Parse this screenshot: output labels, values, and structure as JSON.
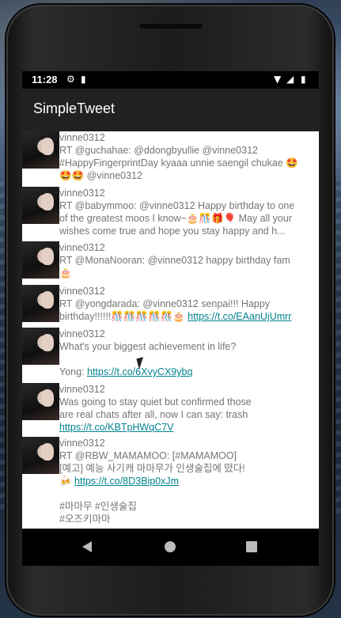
{
  "status_bar": {
    "time": "11:28",
    "icons": [
      "gear-icon",
      "sd-card-icon",
      "wifi-icon",
      "signal-icon",
      "battery-icon"
    ]
  },
  "app_bar": {
    "title": "SimpleTweet"
  },
  "tweets": [
    {
      "username": "vinne0312",
      "text": "RT @guchahae: @ddongbyullie @vinne0312\n#HappyFingerprintDay kyaaa unnie saengil chukae 🤩\n🤩🤩 @vinne0312",
      "link": ""
    },
    {
      "username": "vinne0312",
      "text": "RT @babymmoo: @vinne0312 Happy birthday to one\nof the greatest moos I know~🎂🎊🎁🎈 May all your\nwishes come true and hope you stay happy and h...",
      "link": ""
    },
    {
      "username": "vinne0312",
      "text": "RT @MonaNooran: @vinne0312 happy birthday fam\n🎂",
      "link": ""
    },
    {
      "username": "vinne0312",
      "text": "RT @yongdarada: @vinne0312 senpai!!! Happy\nbirthday!!!!!!🎊🎊🎊🎊🎊🎂 ",
      "link": "https://t.co/EAanUjUmrr"
    },
    {
      "username": "vinne0312",
      "text": "What's your biggest achievement in life?\n\nYong: ",
      "link": "https://t.co/6XvyCX9ybq"
    },
    {
      "username": "vinne0312",
      "text": "Was going to stay quiet but confirmed those\nare real chats after all, now I can say: trash\n",
      "link": "https://t.co/KBTpHWqC7V"
    },
    {
      "username": "vinne0312",
      "text": "RT @RBW_MAMAMOO: [#MAMAMOO]\n[예고] 예능 사기캐 마마무가 인생술집에 떴다!\n🍻 ",
      "link": "https://t.co/8D3Bip0xJm",
      "after_link": "\n\n#마마무 #인생술집\n#오즈키마마"
    }
  ],
  "nav_bar": {
    "back": "back-icon",
    "home": "home-icon",
    "recents": "recents-icon"
  }
}
